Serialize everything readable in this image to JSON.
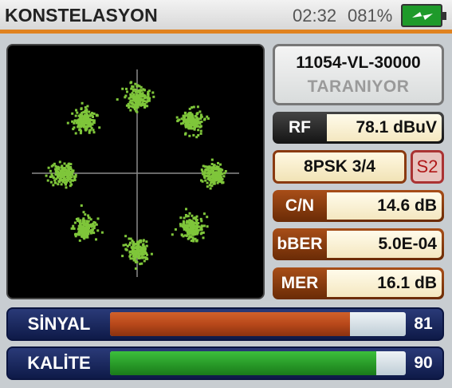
{
  "header": {
    "title": "KONSTELASYON",
    "time": "02:32",
    "battery_percent": "081%",
    "battery_icon": "battery-charging-icon"
  },
  "transponder": {
    "id": "11054-VL-30000",
    "status": "TARANIYOR"
  },
  "rf": {
    "label": "RF",
    "value": "78.1 dBuV"
  },
  "modulation": {
    "value": "8PSK 3/4",
    "standard": "S2"
  },
  "cn": {
    "label": "C/N",
    "value": "14.6 dB"
  },
  "bber": {
    "label": "bBER",
    "value": "5.0E-04"
  },
  "mer": {
    "label": "MER",
    "value": "16.1 dB"
  },
  "signal": {
    "label": "SİNYAL",
    "value": "81",
    "level": 81
  },
  "quality": {
    "label": "KALİTE",
    "value": "90",
    "level": 90
  },
  "colors": {
    "accent": "#e0821f",
    "constellation_dots": "#7fc63a",
    "signal_bar": "#b8481a",
    "quality_bar": "#2a9d2a"
  }
}
